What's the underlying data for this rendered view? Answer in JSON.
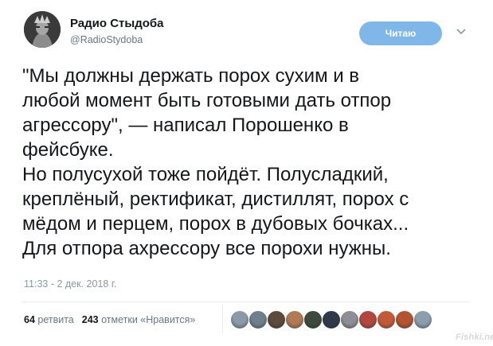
{
  "account": {
    "name": "Радио Стыдоба",
    "handle": "@RadioStydoba"
  },
  "follow_button": {
    "label": "Читаю",
    "color": "#7fb8e8"
  },
  "tweet": {
    "lines": [
      "\"Мы должны держать порох сухим и в",
      "любой момент быть готовыми дать отпор",
      "агрессору\", — написал Порошенко в",
      "фейсбуке.",
      "Но полусухой тоже пойдёт. Полусладкий,",
      "креплёный, ректификат, дистиллят, порох с",
      "мёдом и перцем, порох в дубовых бочках...",
      "Для отпора ахрессору все порохи нужны."
    ],
    "timestamp": "11:33 - 2 дек. 2018 г."
  },
  "stats": {
    "retweets_count": "64",
    "retweets_label": "ретвита",
    "likes_count": "243",
    "likes_label": "отметки «Нравится»"
  },
  "liker_avatar_colors": [
    "#8a9aa8",
    "#6f7f8c",
    "#5c4a3a",
    "#b07a55",
    "#3e4a3e",
    "#2e3a4a",
    "#8e8e96",
    "#b3473f",
    "#c25a3a",
    "#b4532f",
    "#8b9eac"
  ],
  "watermark": "Fishki.net",
  "icons": {
    "chevron": "chevron-down-icon"
  }
}
